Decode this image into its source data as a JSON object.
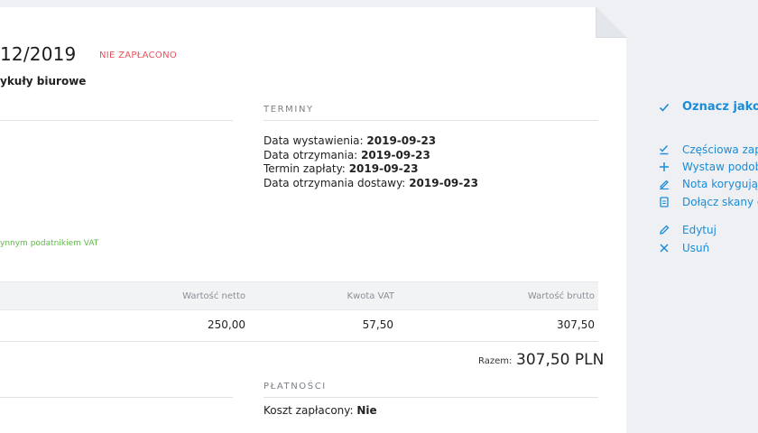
{
  "invoice": {
    "number": "12/2019",
    "status": "NIE ZAPŁACONO",
    "category": "ykuły biurowe"
  },
  "terms": {
    "title": "TERMINY",
    "rows": [
      {
        "label": "Data wystawienia:",
        "value": "2019-09-23"
      },
      {
        "label": "Data otrzymania:",
        "value": "2019-09-23"
      },
      {
        "label": "Termin zapłaty:",
        "value": "2019-09-23"
      },
      {
        "label": "Data otrzymania dostawy:",
        "value": "2019-09-23"
      }
    ]
  },
  "vat_badge": "ynnym podatnikiem VAT",
  "table": {
    "headers": [
      "Wartość netto",
      "Kwota VAT",
      "Wartość brutto"
    ],
    "row": [
      "250,00",
      "57,50",
      "307,50"
    ]
  },
  "total": {
    "label": "Razem:",
    "value": "307,50 PLN"
  },
  "payments": {
    "title": "PŁATNOŚCI",
    "paid_label": "Koszt zapłacony:",
    "paid_value": "Nie"
  },
  "actions": {
    "mark_paid": "Oznacz jako za",
    "partial_payment": "Częściowa zapła",
    "issue_similar": "Wystaw podobn",
    "correction_note": "Nota korygujące",
    "attach_scans": "Dołącz skany do",
    "edit": "Edytuj",
    "delete": "Usuń"
  },
  "colors": {
    "accent": "#1a8cd8",
    "unpaid": "#e5525b",
    "vat": "#5fb84a"
  }
}
